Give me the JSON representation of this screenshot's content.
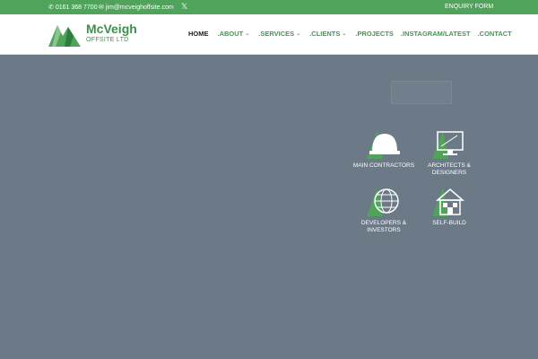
{
  "topbar": {
    "phone": "0161 368 7700",
    "email": "jim@mcveighoffsite.com",
    "social_icon": "x-icon",
    "enquiry": "ENQUIRY FORM"
  },
  "logo": {
    "name": "McVeigh",
    "subtitle": "OFFSITE LTD"
  },
  "nav": {
    "items": [
      {
        "label": "HOME",
        "has_dropdown": false
      },
      {
        "label": ".ABOUT",
        "has_dropdown": true
      },
      {
        "label": ".SERVICES",
        "has_dropdown": true
      },
      {
        "label": ".CLIENTS",
        "has_dropdown": true
      },
      {
        "label": ".PROJECTS",
        "has_dropdown": false
      },
      {
        "label": ".INSTAGRAM/LATEST",
        "has_dropdown": false
      },
      {
        "label": ".CONTACT",
        "has_dropdown": false
      }
    ]
  },
  "categories": [
    {
      "label": "MAIN CONTRACTORS",
      "icon": "hard-hat-icon"
    },
    {
      "label": "ARCHITECTS & DESIGNERS",
      "icon": "monitor-icon"
    },
    {
      "label": "DEVELOPERS & INVESTORS",
      "icon": "globe-icon"
    },
    {
      "label": "SELF-BUILD",
      "icon": "house-icon"
    }
  ],
  "colors": {
    "brand_green": "#4fa35b",
    "hero_bg": "#6b7a86"
  }
}
